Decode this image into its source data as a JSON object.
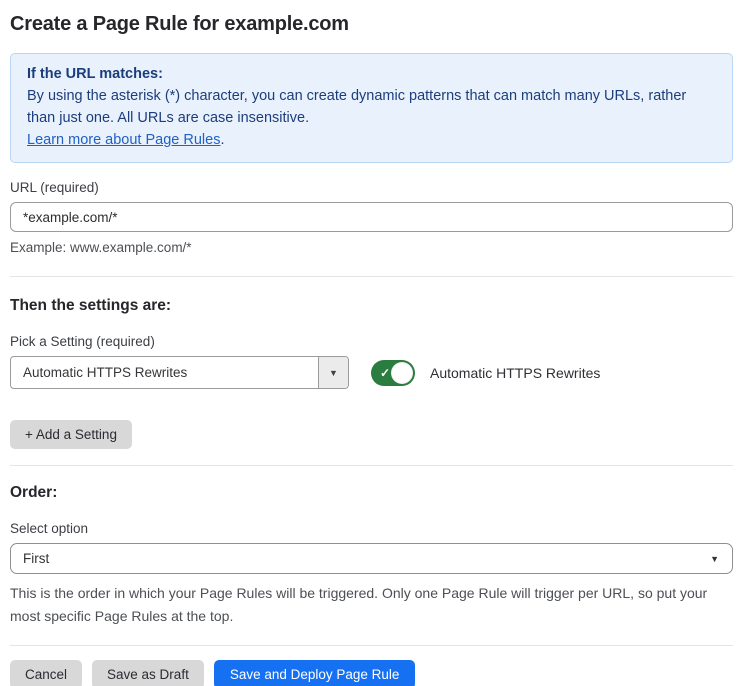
{
  "page": {
    "title": "Create a Page Rule for example.com"
  },
  "info_box": {
    "heading": "If the URL matches:",
    "body": "By using the asterisk (*) character, you can create dynamic patterns that can match many URLs, rather than just one. All URLs are case insensitive.",
    "link_label": "Learn more about Page Rules",
    "link_suffix": "."
  },
  "url_section": {
    "label": "URL (required)",
    "value": "*example.com/*",
    "helper": "Example: www.example.com/*"
  },
  "settings_section": {
    "heading": "Then the settings are:",
    "picker_label": "Pick a Setting (required)",
    "selected_setting": "Automatic HTTPS Rewrites",
    "toggle_state": "on",
    "toggle_label": "Automatic HTTPS Rewrites",
    "add_setting_label": "+ Add a Setting"
  },
  "order_section": {
    "heading": "Order:",
    "label": "Select option",
    "selected_option": "First",
    "helper": "This is the order in which your Page Rules will be triggered. Only one Page Rule will trigger per URL, so put your most specific Page Rules at the top."
  },
  "footer": {
    "cancel_label": "Cancel",
    "save_draft_label": "Save as Draft",
    "save_deploy_label": "Save and Deploy Page Rule"
  },
  "glyphs": {
    "check": "✓",
    "dropdown_arrow": "▼"
  },
  "colors": {
    "info_bg": "#e9f2fc",
    "info_border": "#b9d6f3",
    "info_text": "#1c3d7c",
    "link": "#2160c4",
    "toggle_on": "#2b7c3f",
    "primary_button": "#1671f2",
    "secondary_button": "#d8d8d9"
  }
}
